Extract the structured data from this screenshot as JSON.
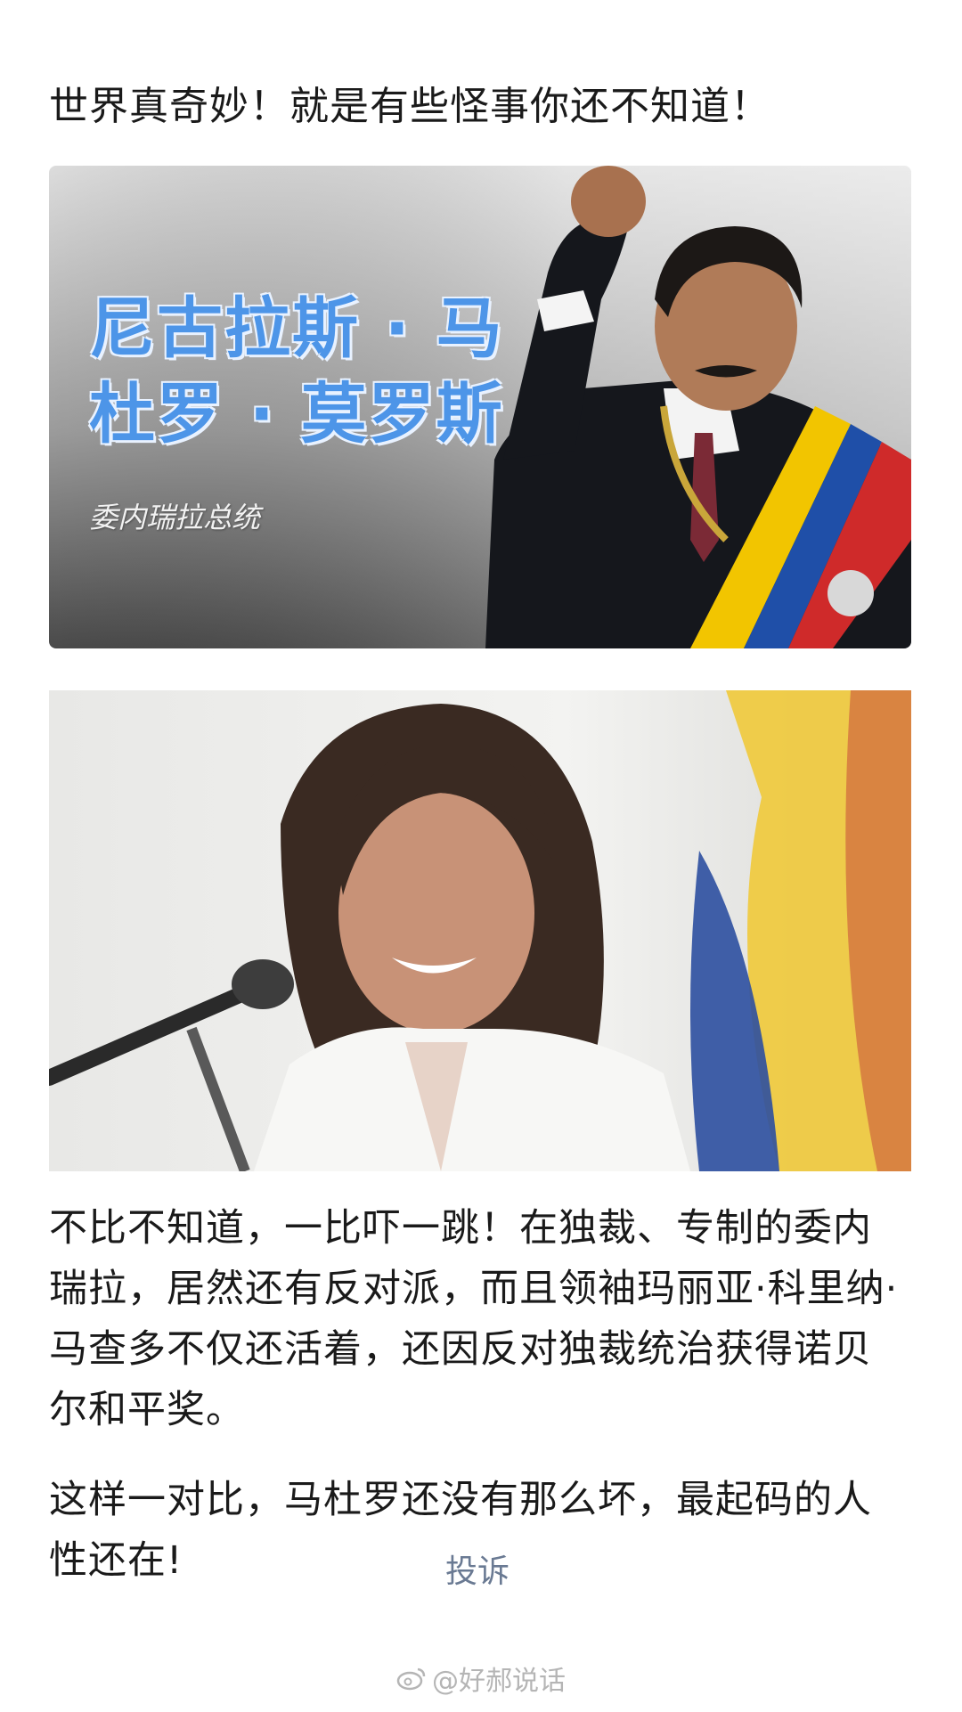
{
  "post": {
    "headline": "世界真奇妙！就是有些怪事你还不知道！",
    "image_1": {
      "caption_line_1": "尼古拉斯 · 马",
      "caption_line_2": "杜罗 · 莫罗斯",
      "caption_sub": "委内瑞拉总统"
    },
    "paragraph_1": "不比不知道，一比吓一跳！在独裁、专制的委内瑞拉，居然还有反对派，而且领袖玛丽亚·科里纳·马查多不仅还活着，还因反对独裁统治获得诺贝尔和平奖。",
    "paragraph_2": "这样一对比，马杜罗还没有那么坏，最起码的人性还在!",
    "complaint_label": "投诉"
  },
  "watermark": {
    "text": "@好郝说话",
    "icon": "weibo-icon"
  },
  "colors": {
    "caption_blue": "#4d95e8",
    "complaint_gray_blue": "#6a7a93",
    "watermark_gray": "#b5b5b5"
  }
}
